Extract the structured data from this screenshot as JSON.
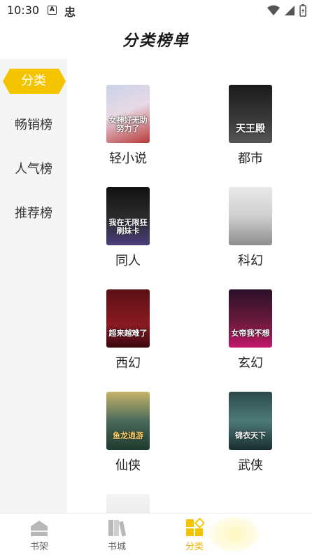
{
  "status_bar": {
    "time": "10:30",
    "icon_a": "A",
    "icon_app": "忠"
  },
  "page_title": "分类榜单",
  "sidebar": {
    "items": [
      {
        "label": "分类",
        "active": true
      },
      {
        "label": "畅销榜",
        "active": false
      },
      {
        "label": "人气榜",
        "active": false
      },
      {
        "label": "推荐榜",
        "active": false
      }
    ]
  },
  "categories": [
    {
      "label": "轻小说",
      "cover_text": "女神好无助努力了"
    },
    {
      "label": "都市",
      "cover_text": "天王殿"
    },
    {
      "label": "同人",
      "cover_text": "我在无限狂刷妹卡"
    },
    {
      "label": "科幻",
      "cover_text": ""
    },
    {
      "label": "西幻",
      "cover_text": "超来越难了"
    },
    {
      "label": "玄幻",
      "cover_text": "女帝我不想"
    },
    {
      "label": "仙侠",
      "cover_text": "鱼龙逍游"
    },
    {
      "label": "武侠",
      "cover_text": "锦衣天下"
    }
  ],
  "bottom_tabs": [
    {
      "label": "书架",
      "icon": "bookshelf-icon",
      "active": false
    },
    {
      "label": "书城",
      "icon": "bookstore-icon",
      "active": false
    },
    {
      "label": "分类",
      "icon": "category-icon",
      "active": true
    }
  ],
  "colors": {
    "accent": "#f5c400",
    "sidebar_bg": "#f5f5f5",
    "active_tab": "#f0b400"
  }
}
